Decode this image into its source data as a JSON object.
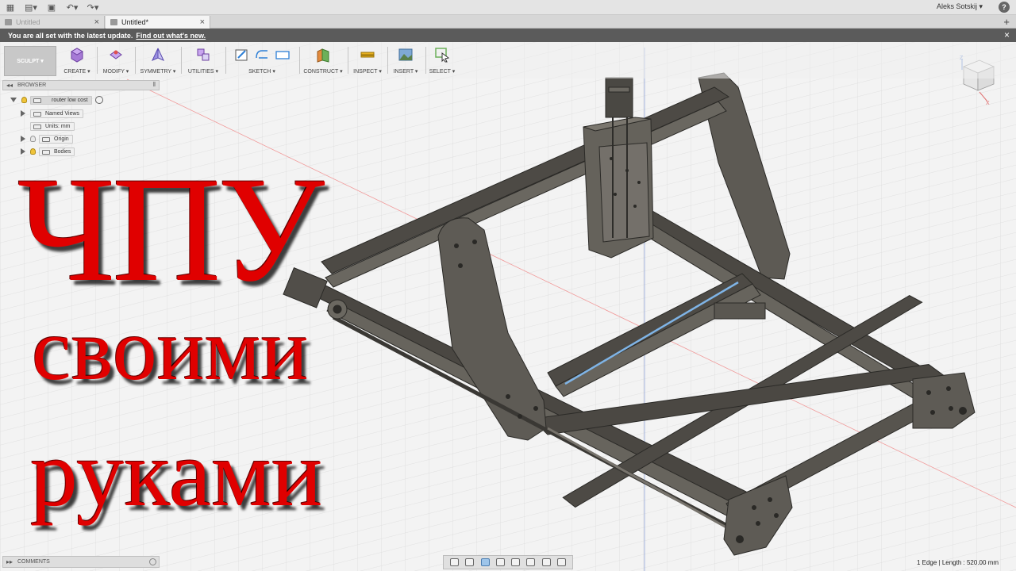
{
  "appbar": {
    "user": "Aleks Sotskij",
    "help": "?"
  },
  "tabs": [
    {
      "label": "Untitled",
      "active": false
    },
    {
      "label": "Untitled*",
      "active": true
    }
  ],
  "notice": {
    "text": "You are all set with the latest update.",
    "link": "Find out what's new."
  },
  "toolbar": {
    "workspace": "SCULPT",
    "groups": [
      {
        "label": "CREATE"
      },
      {
        "label": "MODIFY"
      },
      {
        "label": "SYMMETRY"
      },
      {
        "label": "UTILITIES"
      },
      {
        "label": "SKETCH"
      },
      {
        "label": "CONSTRUCT"
      },
      {
        "label": "INSPECT"
      },
      {
        "label": "INSERT"
      },
      {
        "label": "SELECT"
      }
    ]
  },
  "browser": {
    "title": "BROWSER",
    "root": "router low cost",
    "items": [
      {
        "label": "Named Views"
      },
      {
        "label": "Units: mm"
      },
      {
        "label": "Origin"
      },
      {
        "label": "Bodies"
      }
    ]
  },
  "comments": {
    "title": "COMMENTS"
  },
  "status": {
    "text": "1 Edge | Length : 520.00 mm"
  },
  "overlay": {
    "line1": "ЧПУ",
    "line2": "своими",
    "line3": "руками"
  },
  "colors": {
    "overlay_red": "#e00000",
    "model_body": "#56534d",
    "notice_bg": "#5b5b5b",
    "selected_edge": "#7fb4e6"
  }
}
